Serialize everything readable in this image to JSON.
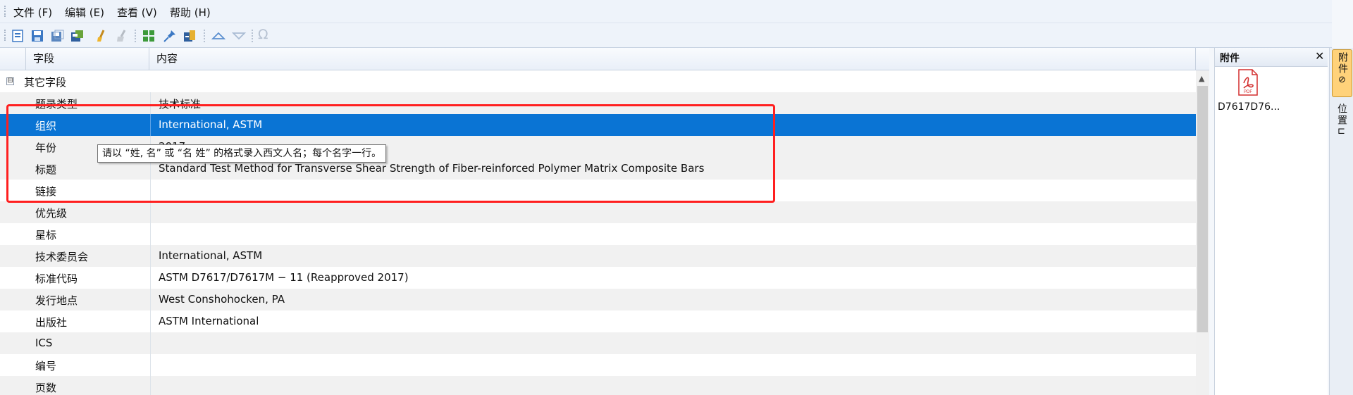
{
  "menu": [
    "文件 (F)",
    "编辑 (E)",
    "查看 (V)",
    "帮助 (H)"
  ],
  "toolbar_icons": [
    "new-item-icon",
    "save-icon",
    "save-all-icon",
    "db-save-icon",
    "clean-icon",
    "clean-disabled-icon",
    "grid-icon",
    "pin-icon",
    "import-icon",
    "move-up-icon",
    "move-down-icon",
    "omega-icon"
  ],
  "grid": {
    "headers": {
      "field": "字段",
      "content": "内容"
    },
    "group": {
      "toggle": "⊟",
      "label": "其它字段"
    },
    "rows": [
      {
        "field": "题录类型",
        "value": "技术标准"
      },
      {
        "field": "组织",
        "value": "International, ASTM"
      },
      {
        "field": "年份",
        "value": "2017"
      },
      {
        "field": "标题",
        "value": "Standard Test Method for Transverse Shear Strength of Fiber-reinforced Polymer Matrix Composite Bars"
      },
      {
        "field": "链接",
        "value": ""
      },
      {
        "field": "优先级",
        "value": ""
      },
      {
        "field": "星标",
        "value": ""
      },
      {
        "field": "技术委员会",
        "value": "International, ASTM"
      },
      {
        "field": "标准代码",
        "value": "ASTM D7617/D7617M − 11 (Reapproved 2017)"
      },
      {
        "field": "发行地点",
        "value": "West Conshohocken, PA"
      },
      {
        "field": "出版社",
        "value": "ASTM International"
      },
      {
        "field": "ICS",
        "value": ""
      },
      {
        "field": "编号",
        "value": ""
      },
      {
        "field": "页数",
        "value": ""
      }
    ],
    "selected_row": "组织"
  },
  "tooltip": "请以 “姓, 名” 或 “名 姓” 的格式录入西文人名；每个名字一行。",
  "attachments": {
    "title": "附件",
    "close": "✕",
    "file_name": "D7617D76...",
    "file_type": "PDF"
  },
  "side_tabs": [
    {
      "label": "附件",
      "icon": "paperclip-icon",
      "active": true
    },
    {
      "label": "位置",
      "icon": "location-icon",
      "active": false
    }
  ],
  "colors": {
    "selection": "#0a74d4",
    "highlight_border": "#ff1f1f",
    "active_tab": "#ffd27a"
  }
}
